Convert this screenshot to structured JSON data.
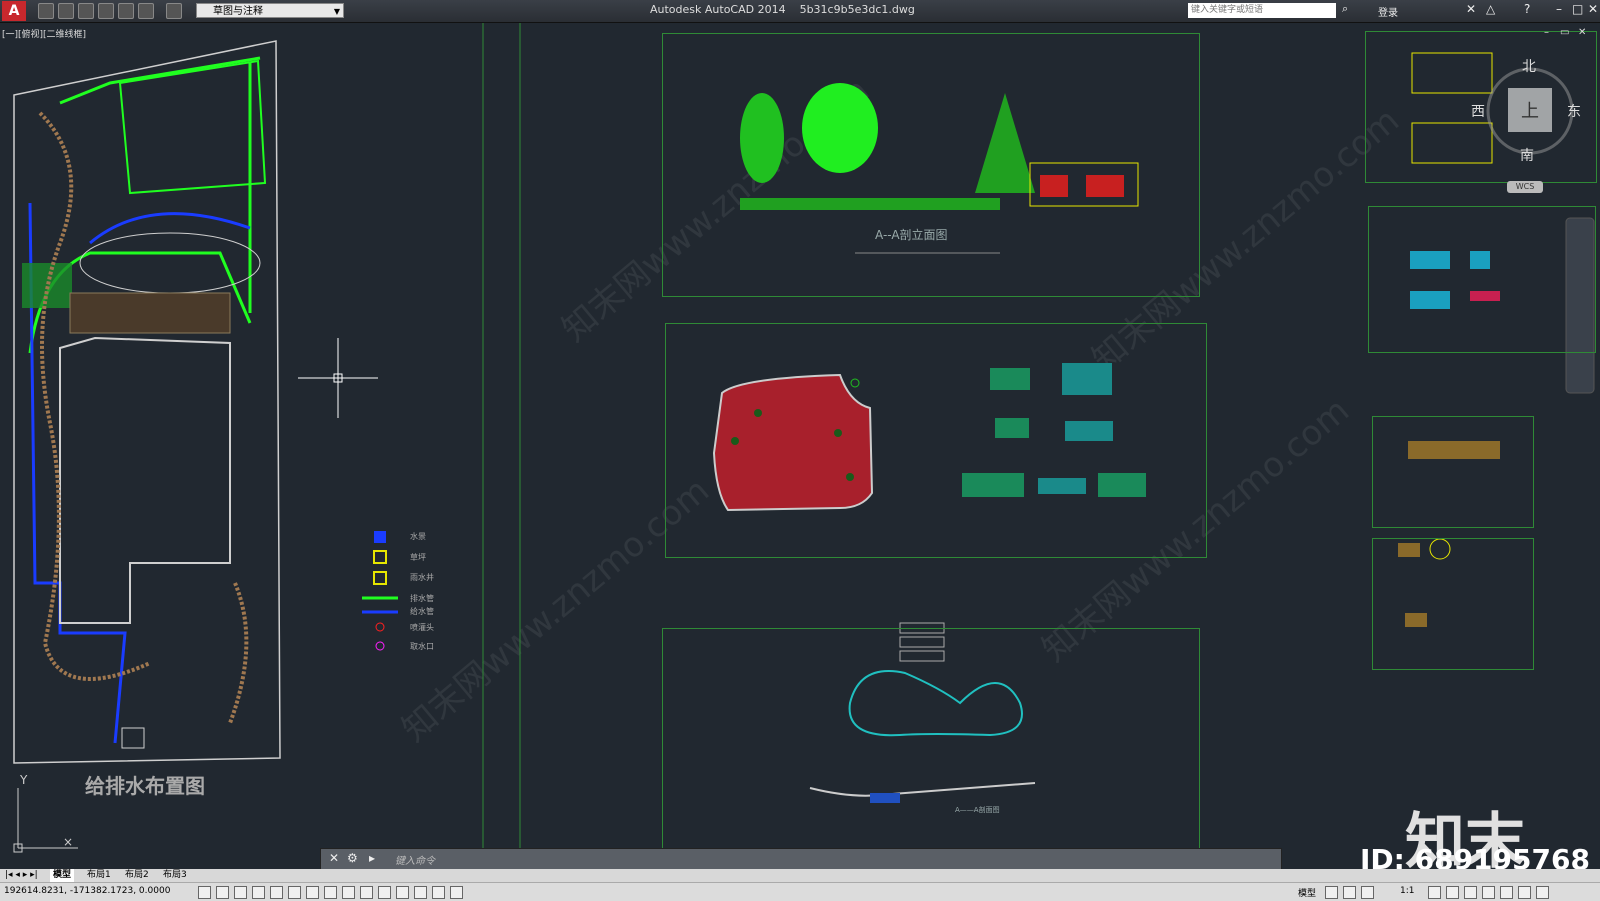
{
  "app": {
    "title": "Autodesk AutoCAD 2014    5b31c9b5e3dc1.dwg",
    "logo_letter": "A",
    "workspace": "草图与注释",
    "search_placeholder": "键入关键字或短语",
    "login": "登录"
  },
  "viewport": {
    "label": "[一][俯视][二维线框]"
  },
  "drawing": {
    "plan_caption": "给排水布置图",
    "elevation_caption": "A--A剖立面图",
    "pond_section_caption": "A——A剖面图",
    "legend": [
      {
        "label": "水景",
        "color": "#1a3cff"
      },
      {
        "label": "草坪",
        "color": "#e6e600"
      },
      {
        "label": "雨水井",
        "color": "#e6e600"
      },
      {
        "label": "排水管",
        "color": "#20ff20"
      },
      {
        "label": "给水管",
        "color": "#1a3cff"
      },
      {
        "label": "喷灌头",
        "color": "#ff2020"
      },
      {
        "label": "取水口",
        "color": "#ff20ff"
      }
    ],
    "viewcube": {
      "north": "北",
      "south": "南",
      "east": "东",
      "west": "西",
      "top": "上",
      "wcs": "WCS"
    },
    "ucs": {
      "y": "Y"
    }
  },
  "command": {
    "placeholder": "键入命令"
  },
  "layout_tabs": [
    "模型",
    "布局1",
    "布局2",
    "布局3"
  ],
  "status": {
    "coordinates": "192614.8231, -171382.1723, 0.0000",
    "model_label": "模型",
    "scale": "1:1"
  },
  "watermark": {
    "text": "知末网www.znzmo.com",
    "brand": "知末",
    "id": "ID: 689195768"
  }
}
